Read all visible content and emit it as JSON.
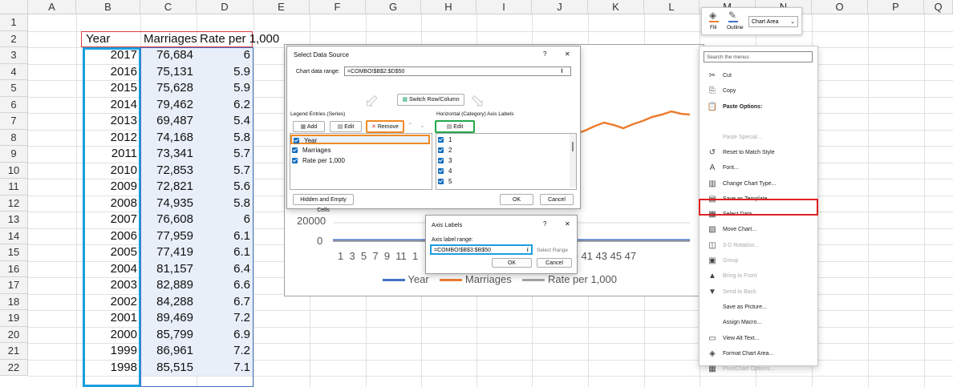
{
  "columns": [
    "A",
    "B",
    "C",
    "D",
    "E",
    "F",
    "G",
    "H",
    "I",
    "J",
    "K",
    "L",
    "M",
    "N",
    "O",
    "P",
    "Q"
  ],
  "rows": [
    "1",
    "2",
    "3",
    "4",
    "5",
    "6",
    "7",
    "8",
    "9",
    "10",
    "11",
    "12",
    "13",
    "14",
    "15",
    "16",
    "17",
    "18",
    "19",
    "20",
    "21",
    "22"
  ],
  "table": {
    "headers": [
      "Year",
      "Marriages",
      "Rate per 1,000"
    ],
    "data": [
      [
        "2017",
        "76,684",
        "6"
      ],
      [
        "2016",
        "75,131",
        "5.9"
      ],
      [
        "2015",
        "75,628",
        "5.9"
      ],
      [
        "2014",
        "79,462",
        "6.2"
      ],
      [
        "2013",
        "69,487",
        "5.4"
      ],
      [
        "2012",
        "74,168",
        "5.8"
      ],
      [
        "2011",
        "73,341",
        "5.7"
      ],
      [
        "2010",
        "72,853",
        "5.7"
      ],
      [
        "2009",
        "72,821",
        "5.6"
      ],
      [
        "2008",
        "74,935",
        "5.8"
      ],
      [
        "2007",
        "76,608",
        "6"
      ],
      [
        "2006",
        "77,959",
        "6.1"
      ],
      [
        "2005",
        "77,419",
        "6.1"
      ],
      [
        "2004",
        "81,157",
        "6.4"
      ],
      [
        "2003",
        "82,889",
        "6.6"
      ],
      [
        "2002",
        "84,288",
        "6.7"
      ],
      [
        "2001",
        "89,469",
        "7.2"
      ],
      [
        "2000",
        "85,799",
        "6.9"
      ],
      [
        "1999",
        "86,961",
        "7.2"
      ],
      [
        "1998",
        "85,515",
        "7.1"
      ]
    ]
  },
  "chart": {
    "ytick_top": "20000",
    "ytick_zero": "0",
    "xticks_left": "1  3  5  7  9  11  1",
    "xticks_right": "; 35 37 39 41 43 45 47",
    "legend": [
      {
        "name": "Year",
        "color": "#4472c4"
      },
      {
        "name": "Marriages",
        "color": "#ed7d31"
      },
      {
        "name": "Rate per 1,000",
        "color": "#a5a5a5"
      }
    ]
  },
  "select_data": {
    "title": "Select Data Source",
    "help": "?",
    "close": "✕",
    "range_label": "Chart data range:",
    "range_value": "=COMBO!$B$2:$D$50",
    "switch_label": "Switch Row/Column",
    "legend_label": "Legend Entries (Series)",
    "add": "Add",
    "edit": "Edit",
    "remove": "Remove",
    "series": [
      "Year",
      "Marriages",
      "Rate per 1,000"
    ],
    "axis_label": "Horizontal (Category) Axis Labels",
    "axis_edit": "Edit",
    "axis_items": [
      "1",
      "2",
      "3",
      "4",
      "5"
    ],
    "hidden_cells": "Hidden and Empty Cells",
    "ok": "OK",
    "cancel": "Cancel"
  },
  "axis_labels": {
    "title": "Axis Labels",
    "help": "?",
    "close": "✕",
    "range_label": "Axis label range:",
    "range_value": "=COMBO!$B$3:$B$50",
    "select_range": "Select Range",
    "ok": "OK",
    "cancel": "Cancel"
  },
  "format_bar": {
    "fill": "Fill",
    "outline": "Outline",
    "element": "Chart Area"
  },
  "context_menu": {
    "search": "Search the menus",
    "items": [
      {
        "label": "Cut",
        "icon": "✂",
        "disabled": false
      },
      {
        "label": "Copy",
        "icon": "⎘",
        "disabled": false
      },
      {
        "label": "Paste Options:",
        "icon": "📋",
        "disabled": false
      },
      {
        "label": "Paste Special...",
        "icon": "",
        "disabled": true
      },
      {
        "label": "Reset to Match Style",
        "icon": "↺",
        "disabled": false
      },
      {
        "label": "Font...",
        "icon": "A",
        "disabled": false
      },
      {
        "label": "Change Chart Type...",
        "icon": "▥",
        "disabled": false
      },
      {
        "label": "Save as Template...",
        "icon": "▤",
        "disabled": false
      },
      {
        "label": "Select Data...",
        "icon": "▦",
        "disabled": false
      },
      {
        "label": "Move Chart...",
        "icon": "▧",
        "disabled": false
      },
      {
        "label": "3-D Rotation...",
        "icon": "◫",
        "disabled": true
      },
      {
        "label": "Group",
        "icon": "▣",
        "disabled": true
      },
      {
        "label": "Bring to Front",
        "icon": "▲",
        "disabled": true
      },
      {
        "label": "Send to Back",
        "icon": "▼",
        "disabled": true
      },
      {
        "label": "Save as Picture...",
        "icon": "",
        "disabled": false
      },
      {
        "label": "Assign Macro...",
        "icon": "",
        "disabled": false
      },
      {
        "label": "View Alt Text...",
        "icon": "▭",
        "disabled": false
      },
      {
        "label": "Format Chart Area...",
        "icon": "◈",
        "disabled": false
      },
      {
        "label": "PivotChart Options...",
        "icon": "▦",
        "disabled": true
      }
    ]
  },
  "highlight_colors": {
    "blue": "#1a9fe0",
    "orange": "#f08a24",
    "green": "#22a84a",
    "red": "#e02020"
  }
}
